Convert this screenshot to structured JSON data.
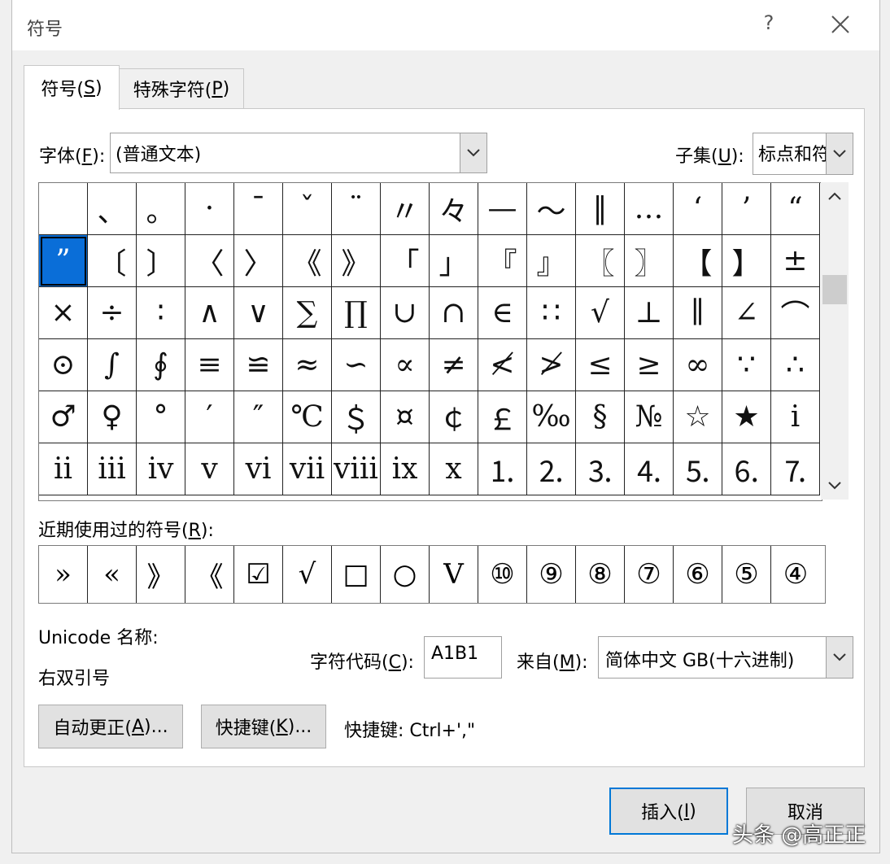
{
  "window": {
    "title": "符号",
    "help": "?"
  },
  "tabs": [
    {
      "label": "符号(",
      "key": "S",
      "suffix": ")"
    },
    {
      "label": "特殊字符(",
      "key": "P",
      "suffix": ")"
    }
  ],
  "font": {
    "label": "字体(",
    "key": "F",
    "suffix": "):",
    "value": "(普通文本)"
  },
  "subset": {
    "label": "子集(",
    "key": "U",
    "suffix": "):",
    "value": "标点和符号"
  },
  "symbols": [
    "",
    "、",
    "。",
    "·",
    "ˉ",
    "ˇ",
    "¨",
    "〃",
    "々",
    "—",
    "～",
    "‖",
    "…",
    "‘",
    "’",
    "“",
    "”",
    "〔",
    "〕",
    "〈",
    "〉",
    "《",
    "》",
    "「",
    "」",
    "『",
    "』",
    "〖",
    "〗",
    "【",
    "】",
    "±",
    "×",
    "÷",
    "∶",
    "∧",
    "∨",
    "∑",
    "∏",
    "∪",
    "∩",
    "∈",
    "∷",
    "√",
    "⊥",
    "∥",
    "∠",
    "⌒",
    "⊙",
    "∫",
    "∮",
    "≡",
    "≌",
    "≈",
    "∽",
    "∝",
    "≠",
    "≮",
    "≯",
    "≤",
    "≥",
    "∞",
    "∵",
    "∴",
    "♂",
    "♀",
    "°",
    "′",
    "″",
    "℃",
    "＄",
    "¤",
    "￠",
    "￡",
    "‰",
    "§",
    "№",
    "☆",
    "★",
    "ⅰ",
    "ⅱ",
    "ⅲ",
    "ⅳ",
    "ⅴ",
    "ⅵ",
    "ⅶ",
    "ⅷ",
    "ⅸ",
    "ⅹ",
    "⒈",
    "⒉",
    "⒊",
    "⒋",
    "⒌",
    "⒍",
    "⒎"
  ],
  "selected_index": 16,
  "recent": {
    "label": "近期使用过的符号(",
    "key": "R",
    "suffix": "):",
    "items": [
      "»",
      "«",
      "》",
      "《",
      "☑",
      "√",
      "□",
      "○",
      "V",
      "⑩",
      "⑨",
      "⑧",
      "⑦",
      "⑥",
      "⑤",
      "④"
    ]
  },
  "unicode_name": {
    "label": "Unicode 名称:",
    "value": "右双引号"
  },
  "char_code": {
    "label": "字符代码(",
    "key": "C",
    "suffix": "):",
    "value": "A1B1"
  },
  "from": {
    "label": "来自(",
    "key": "M",
    "suffix": "):",
    "value": "简体中文 GB(十六进制)"
  },
  "buttons": {
    "autocorrect": {
      "label": "自动更正(",
      "key": "A",
      "suffix": ")..."
    },
    "shortcut": {
      "label": "快捷键(",
      "key": "K",
      "suffix": ")..."
    },
    "insert": {
      "label": "插入(",
      "key": "I",
      "suffix": ")"
    },
    "cancel": {
      "label": "取消"
    }
  },
  "shortcut_info": "快捷键: Ctrl+',\"",
  "watermark": "头条 @高正正"
}
